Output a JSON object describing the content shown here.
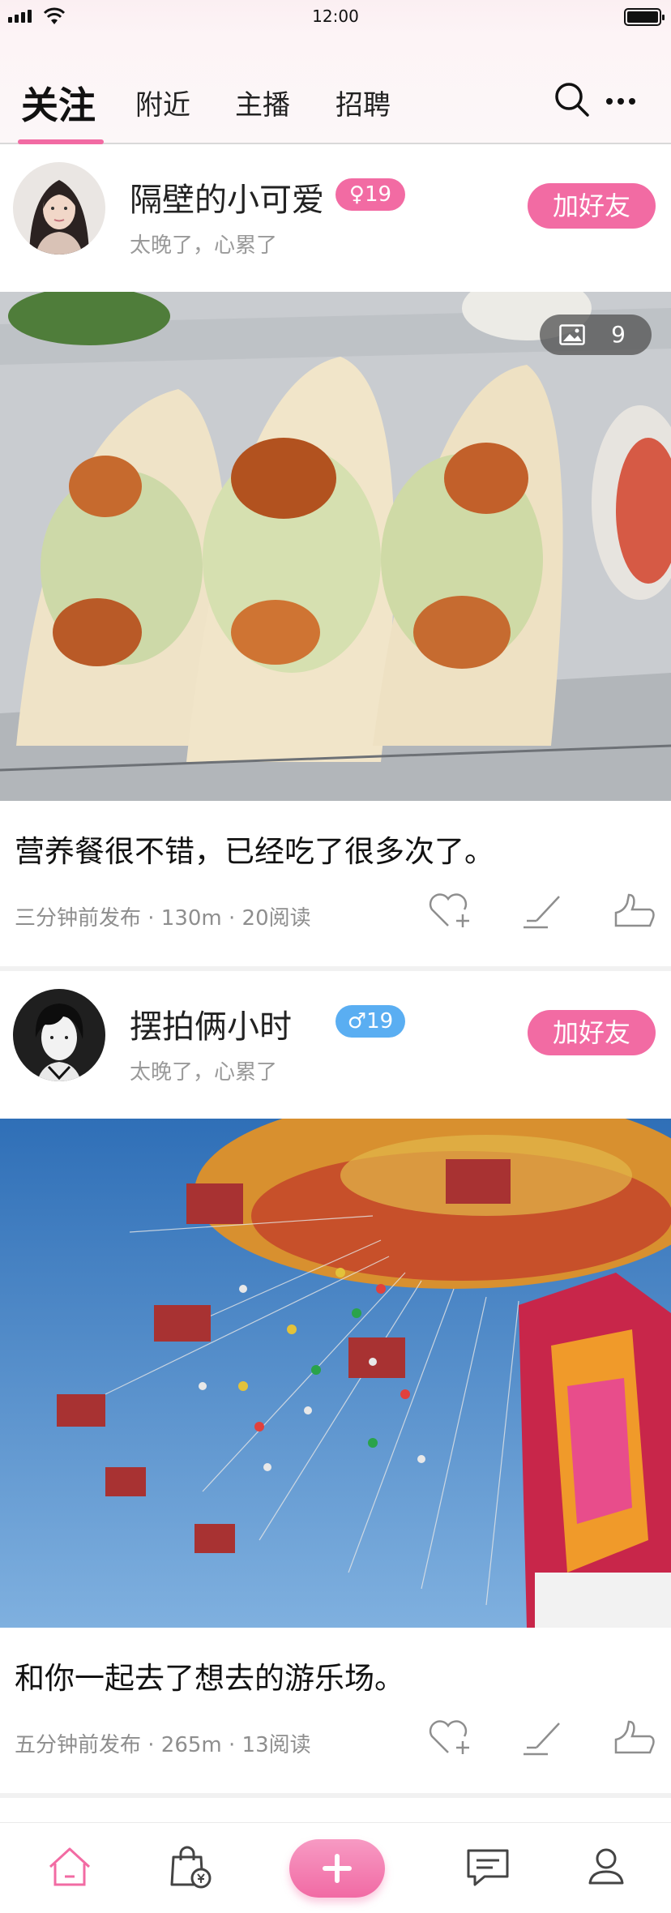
{
  "status_bar": {
    "time": "12:00"
  },
  "nav": {
    "tabs": [
      {
        "label": "关注",
        "active": true
      },
      {
        "label": "附近",
        "active": false
      },
      {
        "label": "主播",
        "active": false
      },
      {
        "label": "招聘",
        "active": false
      }
    ],
    "icons": [
      "search-icon",
      "more-icon"
    ]
  },
  "posts": [
    {
      "author": "隔壁的小可爱",
      "gender_badge": "♀19",
      "gender": "female",
      "subtitle": "太晚了，心累了",
      "add_friend": "加好友",
      "photo_count": "9",
      "caption": "营养餐很不错，已经吃了很多次了。",
      "meta": "三分钟前发布 · 130m · 20阅读"
    },
    {
      "author": "摆拍俩小时",
      "gender_badge": "♂19",
      "gender": "male",
      "subtitle": "太晚了，心累了",
      "add_friend": "加好友",
      "caption": "和你一起去了想去的游乐场。",
      "meta": "五分钟前发布 · 265m · 13阅读"
    }
  ],
  "colors": {
    "accent": "#f26ba3",
    "male": "#5aaef2",
    "meta": "#8e8e8e"
  },
  "bottom_bar": {
    "icons": [
      "home-icon",
      "shop-icon",
      "add-icon",
      "message-icon",
      "profile-icon"
    ],
    "active": "home-icon"
  }
}
